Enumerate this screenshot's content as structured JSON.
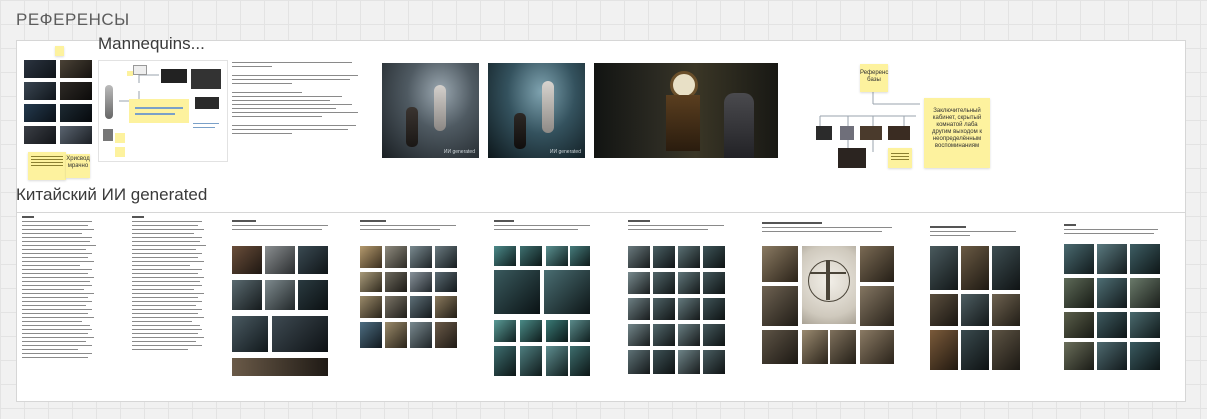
{
  "board": {
    "title": "РЕФЕРЕНСЫ"
  },
  "frames": {
    "top": {
      "label": "Mannequins..."
    },
    "bottom": {
      "label": "Китайский ИИ generated"
    }
  },
  "stickies": {
    "left_note": "Хрисвод мрачно",
    "mindmap_note": "Референс базы",
    "description_note": "Заключительный кабинет, скрытый комнатой лаба другим выходом к неопределённым воспоминаниям"
  },
  "image_tags": {
    "watermark": "ИИ generated"
  },
  "colors": {
    "sticky": "#fdf29e",
    "frame_bg": "#ffffff",
    "canvas_bg": "#f1f1f1",
    "grid": "#e3e3e3"
  }
}
